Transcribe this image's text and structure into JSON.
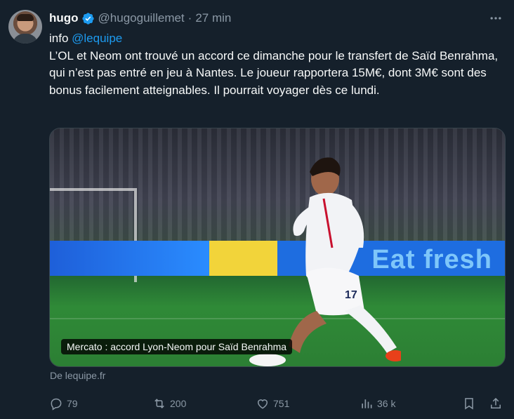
{
  "author": {
    "name": "hugo",
    "handle": "@hugoguillemet",
    "separator": "·",
    "time": "27 min"
  },
  "tweet": {
    "line1_prefix": "info ",
    "mention": "@lequipe",
    "body": "L’OL et Neom ont trouvé un accord ce dimanche pour le transfert de Saïd Benrahma, qui n’est pas entré en jeu à Nantes. Le joueur rapportera 15M€, dont 3M€ sont des bonus facilement atteignables. Il pourrait voyager dès ce lundi."
  },
  "media": {
    "caption": "Mercato : accord Lyon-Neom pour Saïd Benrahma",
    "board_text": "Eat fresh",
    "jersey_number": "17"
  },
  "source": "De lequipe.fr",
  "actions": {
    "replies": "79",
    "reposts": "200",
    "likes": "751",
    "views": "36 k"
  },
  "colors": {
    "background": "#15202b",
    "accent": "#1d9bf0",
    "muted": "#8b98a5"
  },
  "icons": [
    "verified-badge-icon",
    "more-icon",
    "reply-icon",
    "repost-icon",
    "like-icon",
    "views-icon",
    "bookmark-icon",
    "share-icon"
  ]
}
